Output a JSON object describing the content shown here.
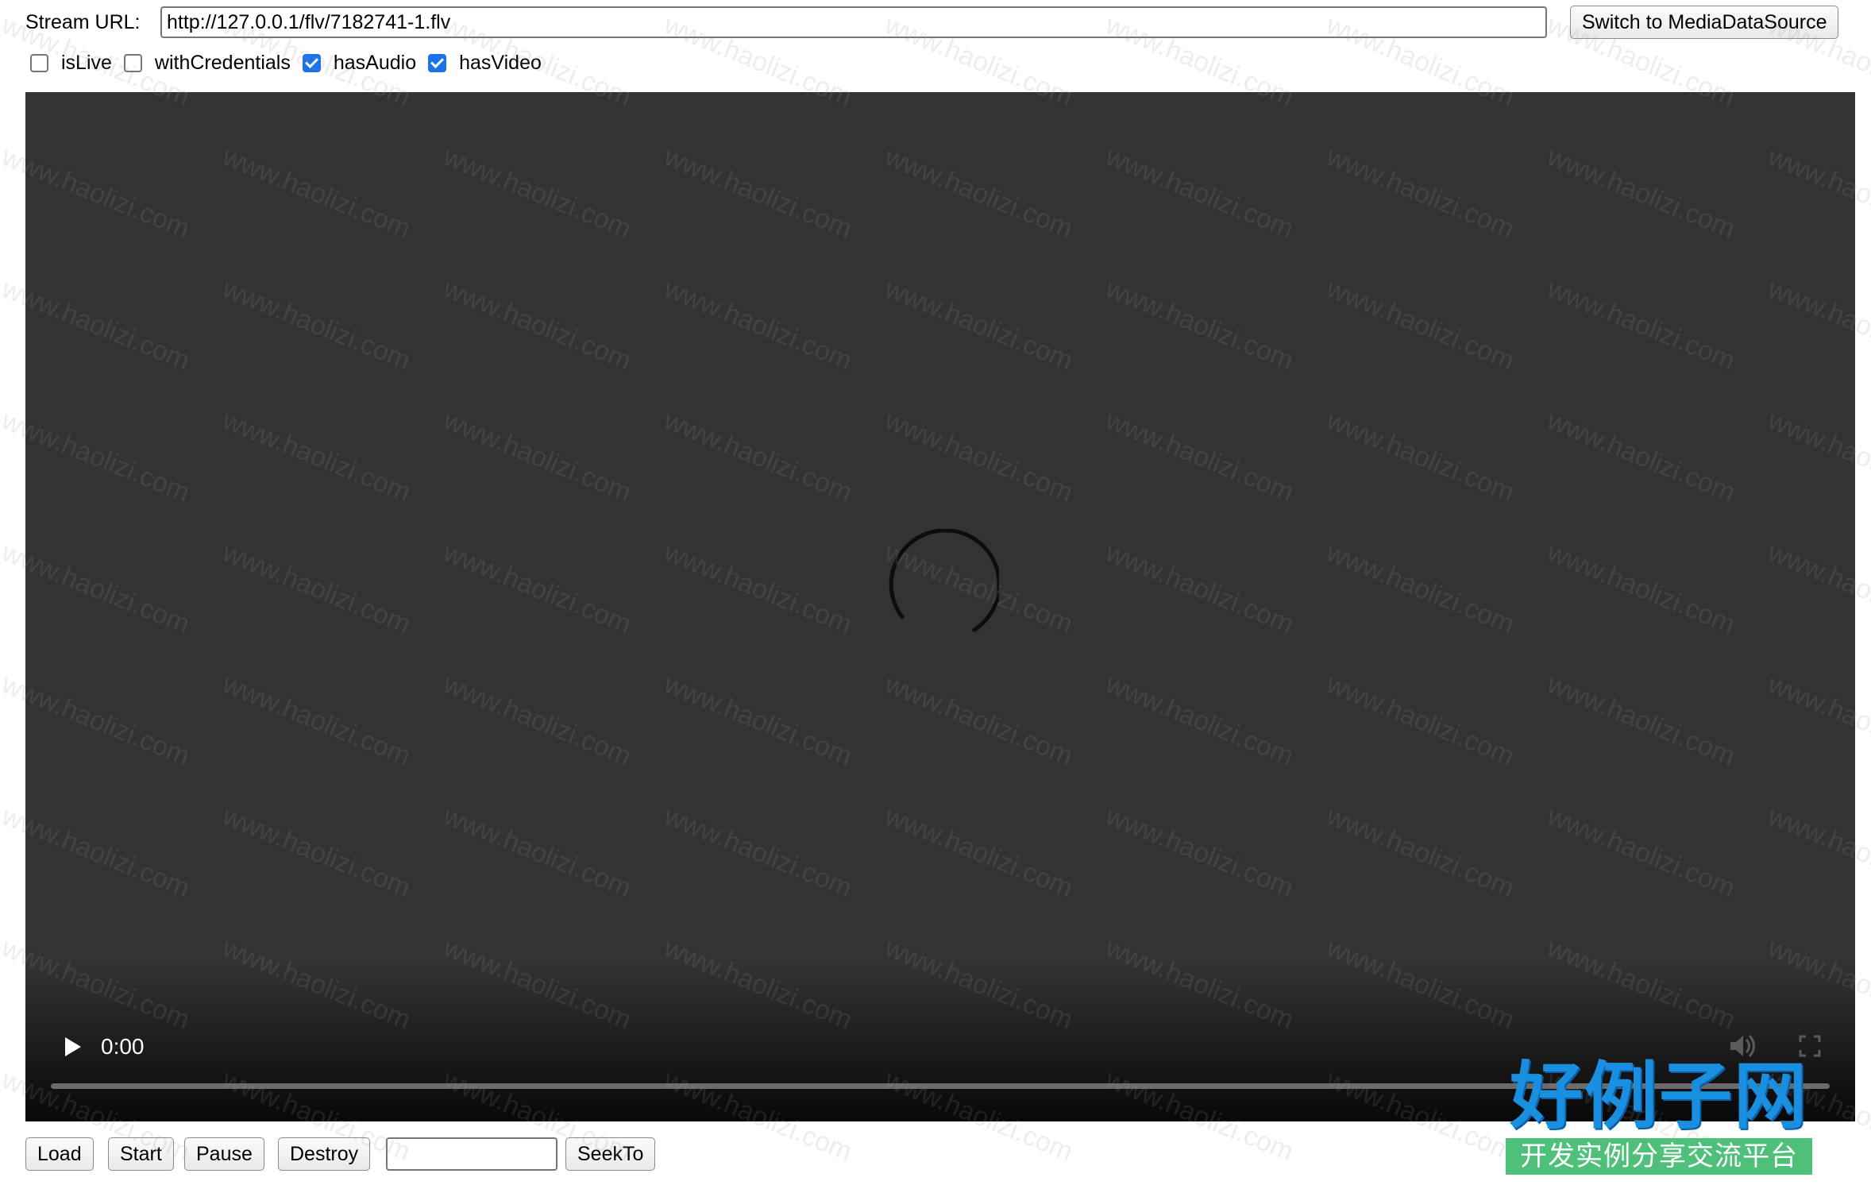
{
  "top_bar": {
    "url_label": "Stream URL:",
    "url_value": "http://127.0.0.1/flv/7182741-1.flv",
    "switch_label": "Switch to MediaDataSource"
  },
  "options": [
    {
      "label": "isLive",
      "checked": false
    },
    {
      "label": "withCredentials",
      "checked": false
    },
    {
      "label": "hasAudio",
      "checked": true
    },
    {
      "label": "hasVideo",
      "checked": true
    }
  ],
  "player": {
    "time": "0:00",
    "state": "loading",
    "progress": 0,
    "icons": [
      "play-icon",
      "volume-icon",
      "fullscreen-icon",
      "loading-spinner"
    ]
  },
  "controls": {
    "load_label": "Load",
    "start_label": "Start",
    "pause_label": "Pause",
    "destroy_label": "Destroy",
    "seek_value": "",
    "seekto_label": "SeekTo"
  },
  "watermark": {
    "text": "www.haolizi.com"
  },
  "brand": {
    "title": "好例子网",
    "subtitle": "开发实例分享交流平台"
  }
}
